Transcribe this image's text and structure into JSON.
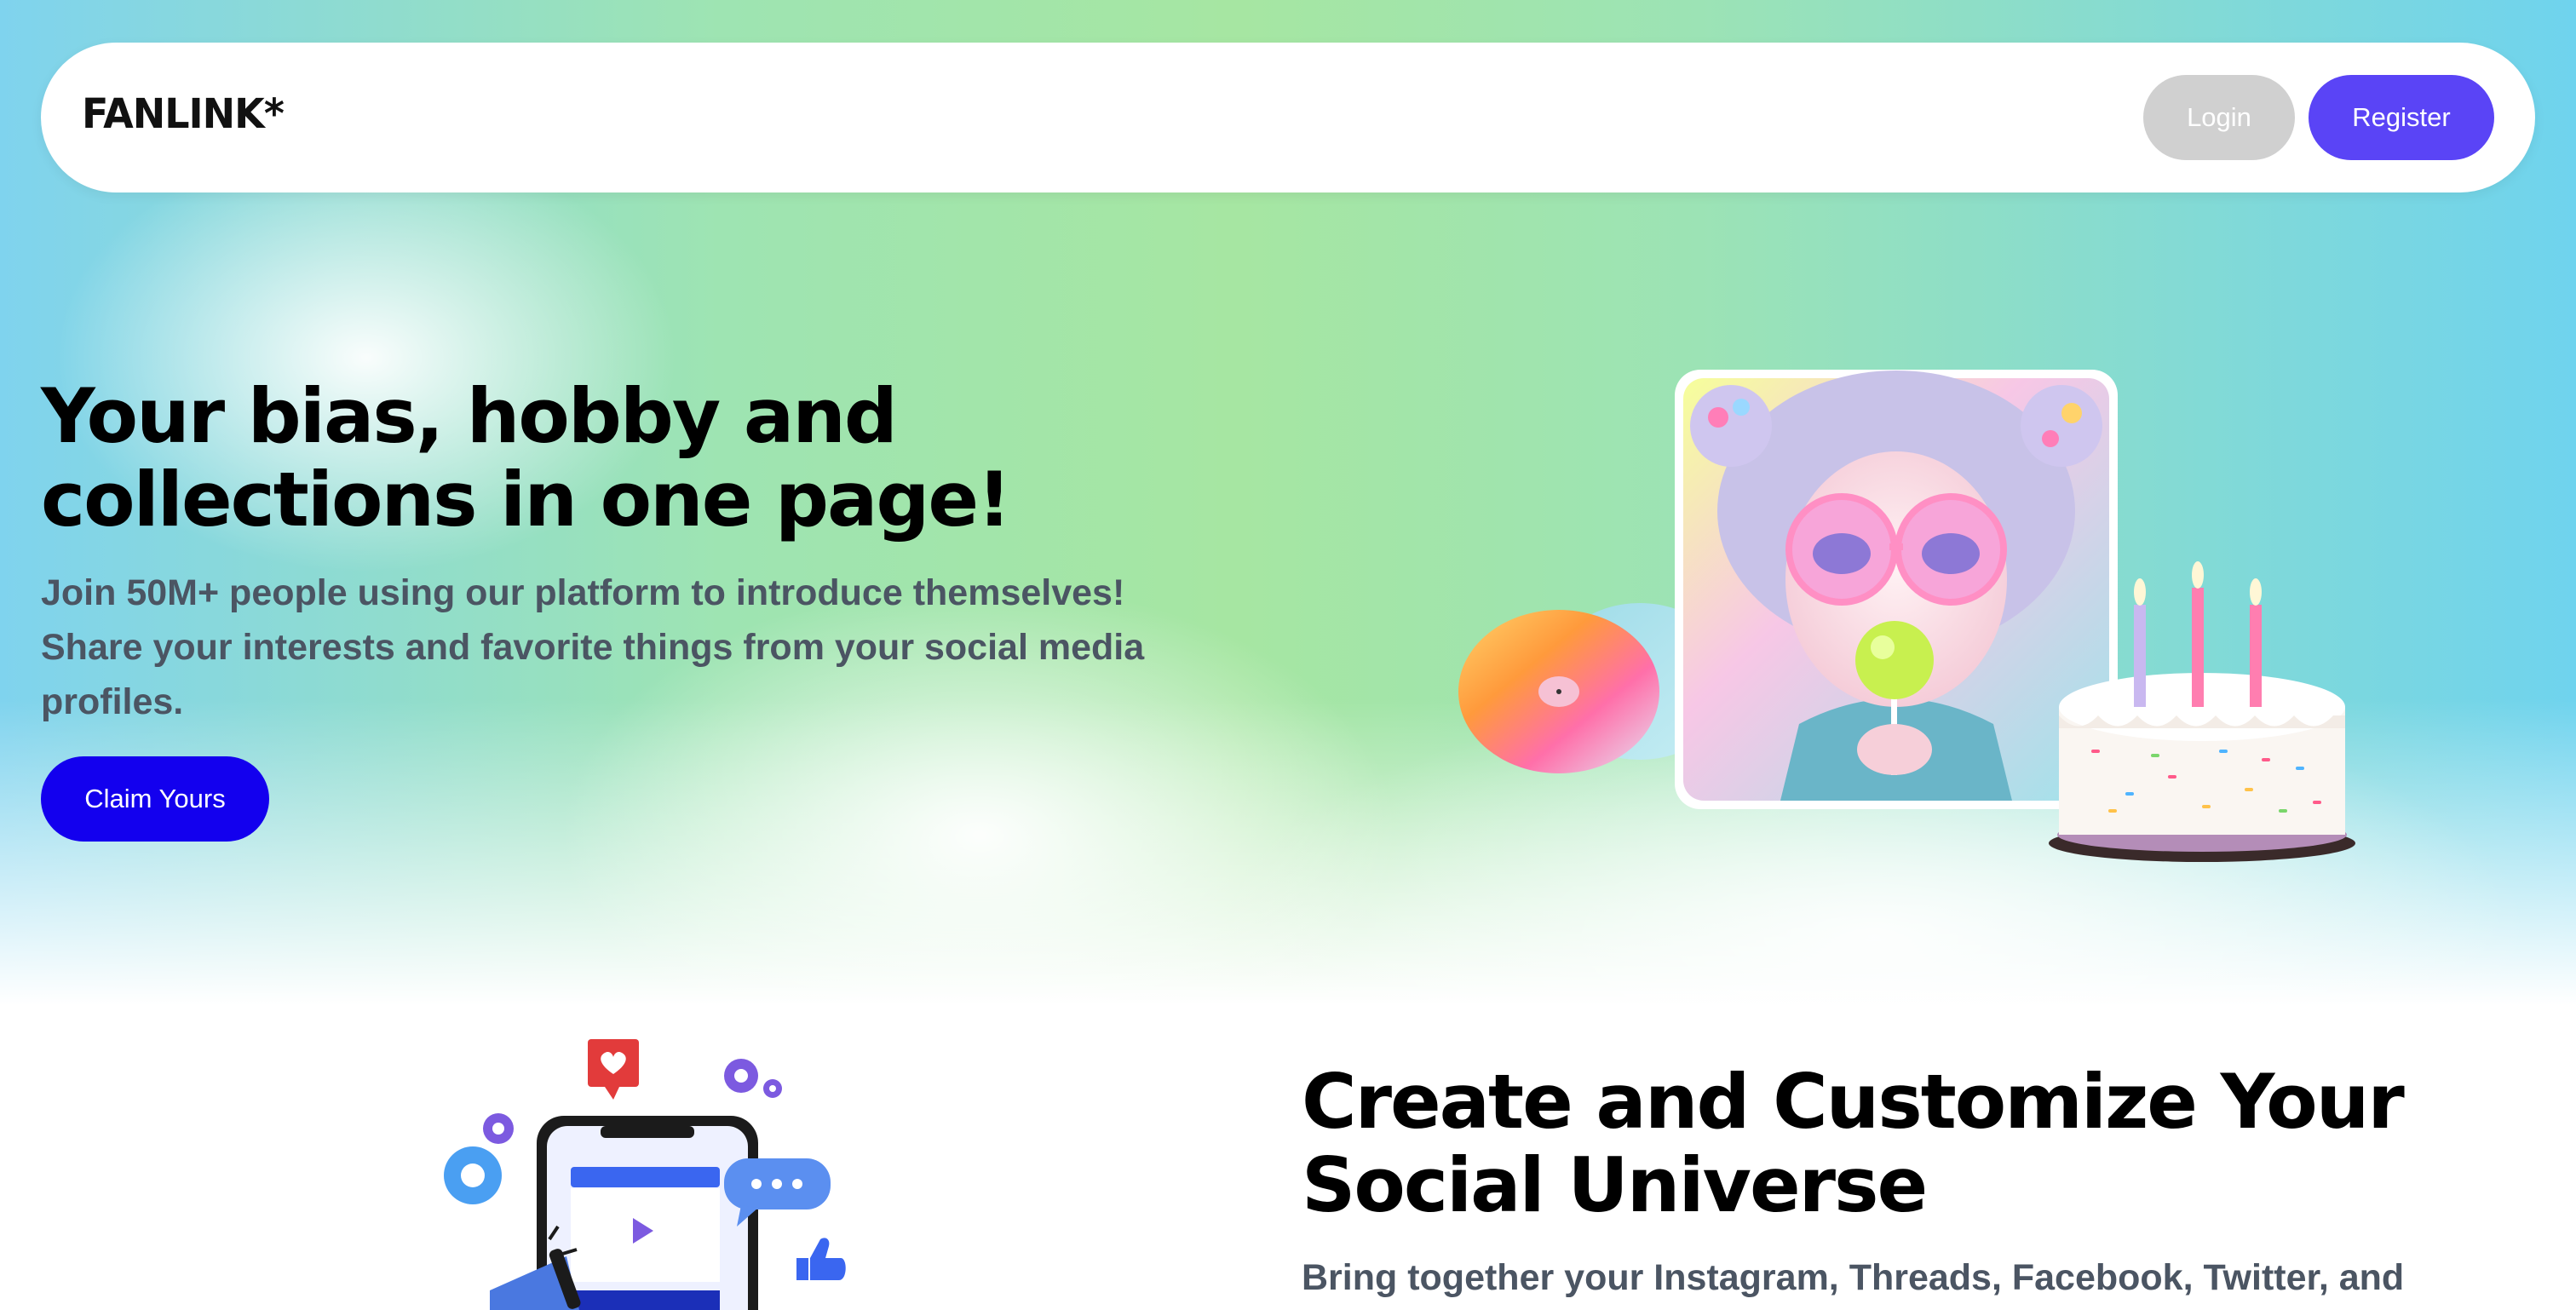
{
  "nav": {
    "logo": "FANLINK*",
    "login_label": "Login",
    "register_label": "Register"
  },
  "hero": {
    "title_line1": "Your bias, hobby and",
    "title_line2": "collections in one page!",
    "subtitle_line1": "Join 50M+ people using our platform to introduce themselves!",
    "subtitle_line2": "Share your interests and favorite things from your social media",
    "subtitle_line3": "profiles.",
    "cta_label": "Claim Yours"
  },
  "section2": {
    "title_line1": "Create and Customize Your",
    "title_line2": "Social Universe",
    "subtitle": "Bring together your Instagram, Threads, Facebook, Twitter, and"
  },
  "colors": {
    "brand": "#5a44f6",
    "cta": "#1300ee",
    "login_bg": "#d0d0d0",
    "body_text": "#4b5563"
  },
  "icons": [
    "vinyl-record-icon",
    "birthday-cake-icon",
    "phone-video-icon",
    "gear-icon",
    "heart-icon",
    "chat-bubble-icon",
    "thumbs-up-icon",
    "megaphone-icon"
  ]
}
